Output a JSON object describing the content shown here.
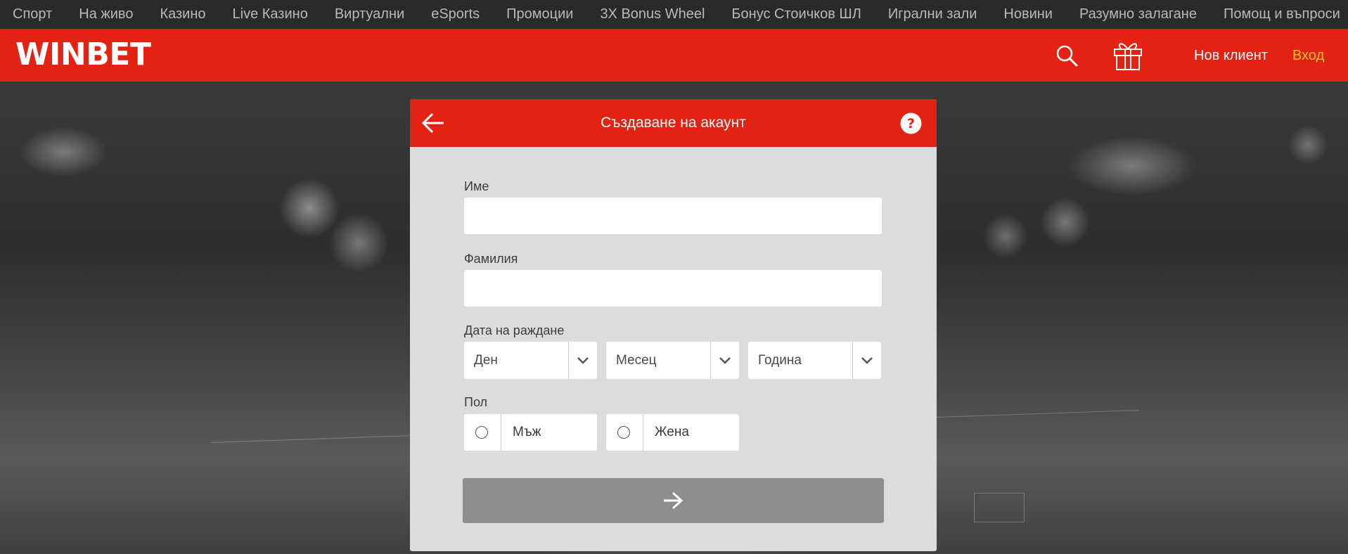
{
  "topnav": {
    "items": [
      {
        "label": "Спорт"
      },
      {
        "label": "На живо"
      },
      {
        "label": "Казино"
      },
      {
        "label": "Live Казино"
      },
      {
        "label": "Виртуални"
      },
      {
        "label": "eSports"
      },
      {
        "label": "Промоции"
      },
      {
        "label": "3X Bonus Wheel"
      },
      {
        "label": "Бонус Стоичков ШЛ"
      },
      {
        "label": "Игрални зали"
      },
      {
        "label": "Новини"
      },
      {
        "label": "Разумно залагане"
      },
      {
        "label": "Помощ и въпроси"
      }
    ]
  },
  "header": {
    "logo": "WINBET",
    "search_icon": "search-icon",
    "gift_icon": "gift-icon",
    "new_client": "Нов клиент",
    "login": "Вход",
    "brand_color": "#e32214",
    "login_color": "#f5c02c"
  },
  "modal": {
    "title": "Създаване на акаунт",
    "back_icon": "arrow-left-icon",
    "help_icon": "help-icon",
    "first_name": {
      "label": "Име",
      "value": ""
    },
    "last_name": {
      "label": "Фамилия",
      "value": ""
    },
    "dob": {
      "label": "Дата на раждане",
      "day": "Ден",
      "month": "Месец",
      "year": "Година"
    },
    "gender": {
      "label": "Пол",
      "male": "Мъж",
      "female": "Жена"
    },
    "submit_icon": "arrow-right-icon",
    "submit_color": "#8e8e8e"
  }
}
